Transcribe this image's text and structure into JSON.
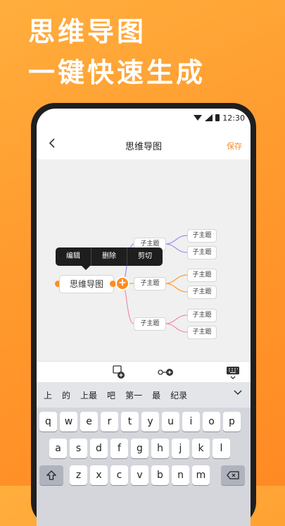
{
  "promo": {
    "line1": "思维导图",
    "line2": "一键快速生成"
  },
  "status_bar": {
    "time": "12:30",
    "icons": [
      "wifi-icon",
      "signal-icon",
      "battery-icon"
    ]
  },
  "nav": {
    "back_icon": "chevron-left-icon",
    "title": "思维导图",
    "save_label": "保存"
  },
  "mindmap": {
    "root": "思维导图",
    "branches": [
      {
        "label": "子主题",
        "color": "#9C8CF0",
        "children": [
          "子主题",
          "子主题"
        ]
      },
      {
        "label": "子主题",
        "color": "#FF9A2E",
        "children": [
          "子主题",
          "子主题"
        ]
      },
      {
        "label": "子主题",
        "color": "#F08CA8",
        "children": [
          "子主题",
          "子主题"
        ]
      }
    ]
  },
  "context_menu": {
    "items": [
      "编辑",
      "删除",
      "剪切"
    ]
  },
  "toolbar": {
    "icons": [
      "add-child-node-icon",
      "add-sibling-node-icon",
      "keyboard-hide-icon"
    ]
  },
  "ime_suggestions": [
    "上",
    "的",
    "上最",
    "吧",
    "第一",
    "最",
    "纪录"
  ],
  "keyboard": {
    "row1": [
      "q",
      "w",
      "e",
      "r",
      "t",
      "y",
      "u",
      "i",
      "o",
      "p"
    ],
    "row2": [
      "a",
      "s",
      "d",
      "f",
      "g",
      "h",
      "j",
      "k",
      "l"
    ],
    "row3": [
      "z",
      "x",
      "c",
      "v",
      "b",
      "n",
      "m"
    ]
  },
  "colors": {
    "accent": "#FF8C1F",
    "background_orange": "#FF9A2E"
  }
}
